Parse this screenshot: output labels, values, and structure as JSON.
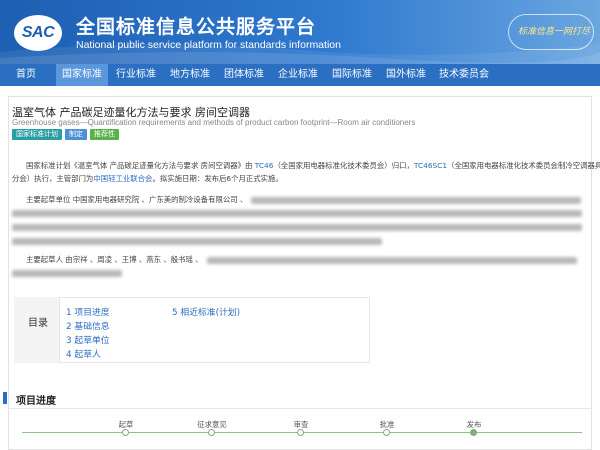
{
  "header": {
    "logo_text": "SAC",
    "title": "全国标准信息公共服务平台",
    "subtitle": "National public service platform  for standards information",
    "slogan": "标准信息一网打尽"
  },
  "nav": {
    "items": [
      {
        "label": "首页"
      },
      {
        "label": "国家标准"
      },
      {
        "label": "行业标准"
      },
      {
        "label": "地方标准"
      },
      {
        "label": "团体标准"
      },
      {
        "label": "企业标准"
      },
      {
        "label": "国际标准"
      },
      {
        "label": "国外标准"
      },
      {
        "label": "技术委员会"
      }
    ],
    "active_index": 1
  },
  "standard": {
    "title": "温室气体 产品碳足迹量化方法与要求 房间空调器",
    "title_en": "Greenhouse gases—Quantification requirements and methods of product carbon footprint—Room air conditioners",
    "tags": [
      "国家标准计划",
      "制定",
      "推荐性"
    ]
  },
  "body": {
    "para1": {
      "part1": "国家标准计划《温室气体 产品碳足迹量化方法与要求 房间空调器》由 ",
      "tc": "TC46",
      "part2": "（全国家用电器标准化技术委员会）归口，",
      "sc": "TC46SC1",
      "part3": "（全国家用电器标准化技术委员会制冷空调器具",
      "line2_a": "分会）执行，主管部门为",
      "dept": "中国轻工业联合会",
      "line2_b": "。拟实施日期：发布后6个月正式实施。"
    },
    "orgs_line": "主要起草单位 中国家用电器研究院 、广东美的制冷设备有限公司 、",
    "people_line": "主要起草人 由宗祥 、周凌 、王博 、燕东 、殷书瑶 、"
  },
  "toc": {
    "label": "目录",
    "items": [
      "1 项目进度",
      "2 基础信息",
      "3 起草单位",
      "4 起草人",
      "5 相近标准(计划)"
    ]
  },
  "progress": {
    "title": "项目进度",
    "steps": [
      "起草",
      "征求意见",
      "审查",
      "批准",
      "发布"
    ],
    "current_index": 4
  },
  "colors": {
    "header_blue": "#1d5fb3",
    "nav_blue": "#2a6fc2",
    "nav_active": "#5b97dd",
    "link": "#2b6cc0",
    "tag_teal": "#2a9fa3",
    "tag_blue": "#4d8fd6",
    "tag_green": "#58b44a",
    "timeline_green": "#7fb07a"
  }
}
